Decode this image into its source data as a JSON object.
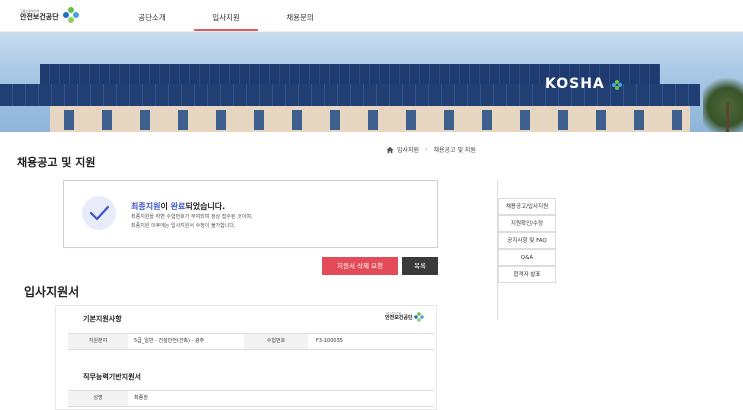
{
  "logo": {
    "small": "고용노동부산하",
    "name": "안전보건공단"
  },
  "nav": [
    {
      "label": "공단소개",
      "active": false
    },
    {
      "label": "입사지원",
      "active": true
    },
    {
      "label": "채용문의",
      "active": false
    }
  ],
  "banner": {
    "brand": "KOSHA"
  },
  "page": {
    "title": "채용공고 및 지원"
  },
  "breadcrumb": {
    "home": "입사지원",
    "current": "채용공고 및 지원"
  },
  "complete": {
    "title_highlight": "최종지원",
    "title_mid": "이 ",
    "title_highlight2": "완료",
    "title_end": "되었습니다.",
    "desc_line1": "최종지원을 하면 수험번호가 부여되며 정상 접수된 것이며,",
    "desc_line2": "최종지원 이후에는 입사지원서 수정이 불가합니다."
  },
  "buttons": {
    "delete": "지원서 삭제 요청",
    "list": "목록"
  },
  "side_menu": [
    "채용공고/입사지원",
    "지원확인/수정",
    "공지사항 및 FAQ",
    "Q&A",
    "합격자 발표"
  ],
  "application": {
    "title": "입사지원서",
    "basic_section": "기본지원사항",
    "field_label": "지원분야",
    "field_value": "5급_일반 - 건설안전(건축) - 광주",
    "exam_label": "수험번호",
    "exam_value": "F3-100035",
    "competency_section": "직무능력기반지원서",
    "name_label": "성명",
    "name_value": "최종권"
  },
  "colors": {
    "accent_red": "#e24b57",
    "accent_blue": "#3a57c8",
    "dark_button": "#3a3a3a",
    "logo_green": "#6cbd45",
    "logo_blue": "#1f6fc4"
  }
}
